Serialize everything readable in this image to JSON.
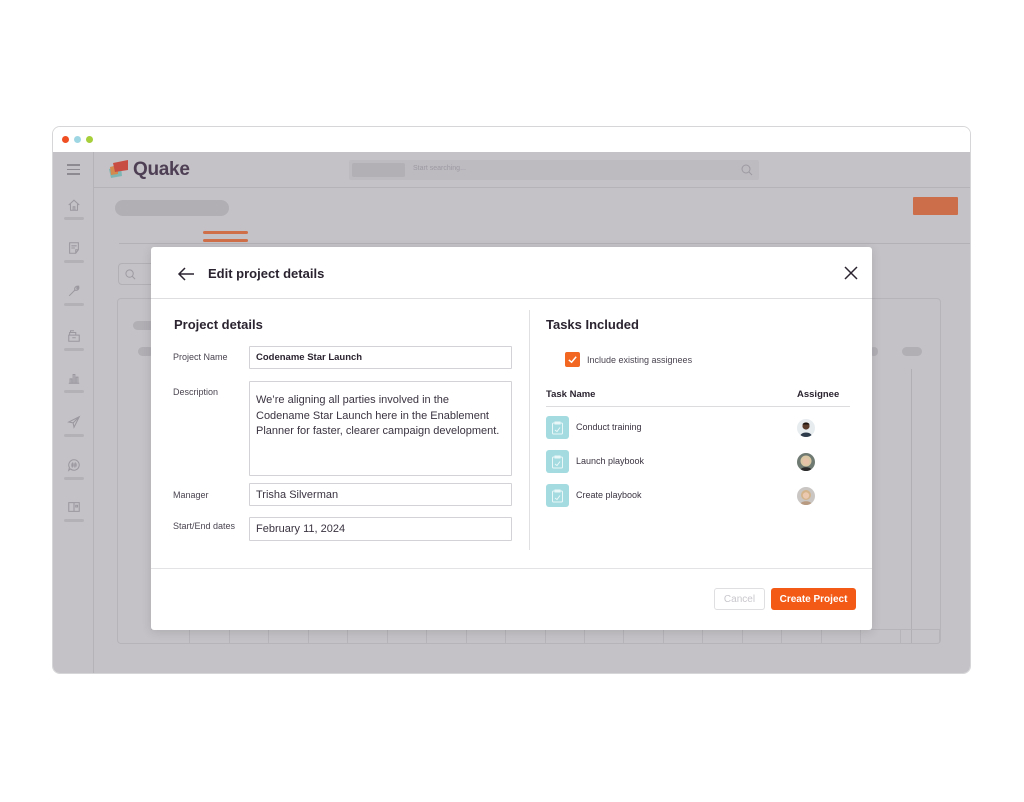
{
  "window": {
    "controls": [
      "close",
      "minimize",
      "maximize"
    ]
  },
  "app": {
    "name": "Quake",
    "search": {
      "placeholder": "Start searching..."
    },
    "sidebar": {
      "items": [
        {
          "icon": "home-icon"
        },
        {
          "icon": "note-icon"
        },
        {
          "icon": "wrench-icon"
        },
        {
          "icon": "archive-icon"
        },
        {
          "icon": "bar-chart-icon"
        },
        {
          "icon": "send-icon"
        },
        {
          "icon": "chat-hash-icon"
        },
        {
          "icon": "layout-icon"
        }
      ]
    }
  },
  "modal": {
    "title": "Edit project details",
    "project_details": {
      "heading": "Project details",
      "fields": {
        "project_name": {
          "label": "Project Name",
          "value": "Codename Star Launch"
        },
        "description": {
          "label": "Description",
          "value": "We’re aligning all parties involved in the Codename Star Launch here in the Enablement Planner for faster, clearer campaign development."
        },
        "manager": {
          "label": "Manager",
          "value": "Trisha Silverman"
        },
        "dates": {
          "label": "Start/End dates",
          "value": "February 11, 2024"
        }
      }
    },
    "tasks": {
      "heading": "Tasks Included",
      "include_assignees": {
        "label": "Include existing assignees",
        "checked": true
      },
      "columns": {
        "name": "Task Name",
        "assignee": "Assignee"
      },
      "rows": [
        {
          "name": "Conduct training",
          "assignee_avatar": "avatar-1"
        },
        {
          "name": "Launch playbook",
          "assignee_avatar": "avatar-2"
        },
        {
          "name": "Create playbook",
          "assignee_avatar": "avatar-3"
        }
      ]
    },
    "buttons": {
      "cancel": "Cancel",
      "create": "Create Project"
    }
  },
  "colors": {
    "accent": "#f25a16",
    "checkbox": "#f26722",
    "task_icon_bg": "#a3dbe0",
    "overlay": "#c4c2c6"
  }
}
